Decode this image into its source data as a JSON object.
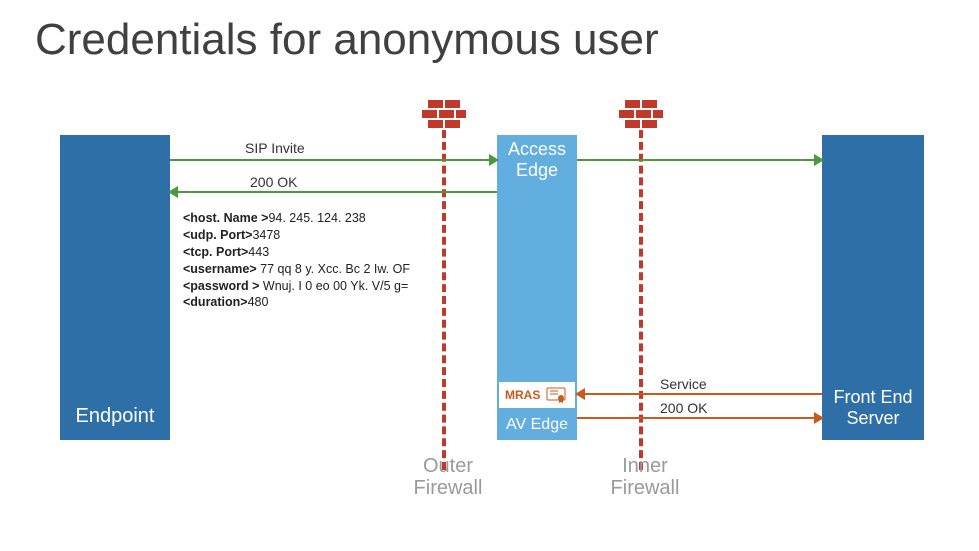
{
  "title": "Credentials for anonymous user",
  "endpoint": {
    "label": "Endpoint"
  },
  "edge": {
    "access_label": "Access\nEdge",
    "mras_label": "MRAS",
    "av_label": "AV Edge"
  },
  "front": {
    "label": "Front End\nServer"
  },
  "firewalls": {
    "outer": "Outer\nFirewall",
    "inner": "Inner\nFirewall"
  },
  "flows": {
    "sip_invite": "SIP Invite",
    "ok1": "200 OK",
    "service": "Service",
    "ok2": "200 OK"
  },
  "credentials": {
    "hostName": "94. 245. 124. 238",
    "udpPort": "3478",
    "tcpPort": "443",
    "username": "77 qq 8 y. Xcc. Bc 2 Iw. OF",
    "password": "Wnuj. I 0 eo 00 Yk. V/5 g=",
    "duration": "480"
  },
  "colors": {
    "lync_dark": "#2f6fa8",
    "lync_light": "#62aedf",
    "firewall": "#c0392b",
    "accent_green": "#4a9a3d",
    "accent_orange": "#c85a1a"
  }
}
